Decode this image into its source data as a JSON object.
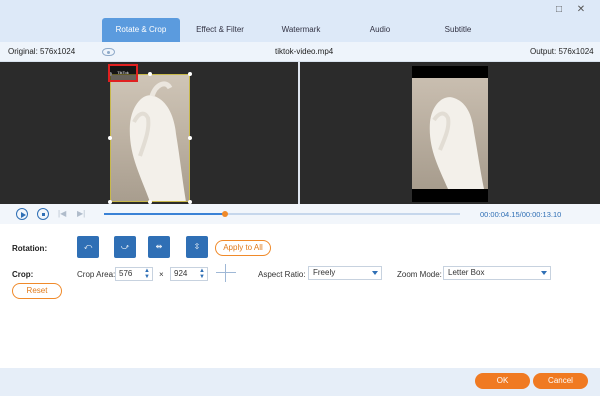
{
  "window": {
    "tabs": [
      "Rotate & Crop",
      "Effect & Filter",
      "Watermark",
      "Audio",
      "Subtitle"
    ],
    "active_tab": "Rotate & Crop",
    "restore_icon": "□",
    "close_icon": "✕"
  },
  "infobar": {
    "original": "Original: 576x1024",
    "filename": "tiktok-video.mp4",
    "output": "Output: 576x1024"
  },
  "preview": {
    "watermark_text": "TikTok"
  },
  "playback": {
    "timecode": "00:00:04.15/00:00:13.10",
    "progress_percent": 34
  },
  "rotation": {
    "label": "Rotation:",
    "buttons": [
      "⤺",
      "⤻",
      "⇹",
      "⇳"
    ],
    "apply_all": "Apply to All"
  },
  "crop": {
    "label": "Crop:",
    "area_label": "Crop Area:",
    "width": "576",
    "x_sep": "×",
    "height": "924",
    "aspect_label": "Aspect Ratio:",
    "aspect_value": "Freely",
    "zoom_label": "Zoom Mode:",
    "zoom_value": "Letter Box",
    "reset": "Reset"
  },
  "footer": {
    "ok": "OK",
    "cancel": "Cancel"
  },
  "colors": {
    "accent": "#2f6fb5",
    "orange": "#f07a22",
    "active_tab": "#5b9bde"
  }
}
